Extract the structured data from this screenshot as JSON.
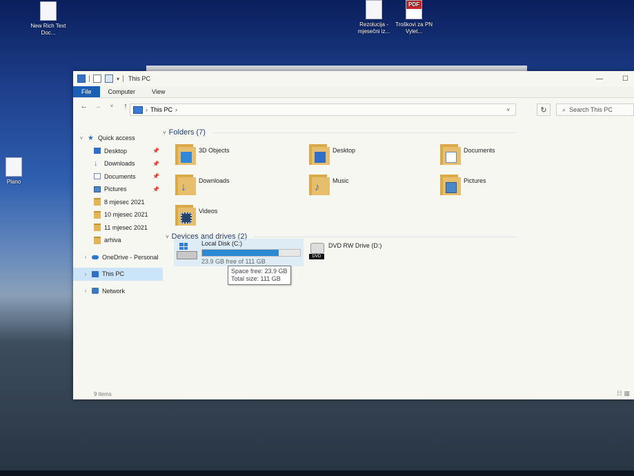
{
  "desktop": {
    "icons": [
      {
        "label": "New Rich Text Doc...",
        "icon": "rtf-document-icon"
      },
      {
        "label": "Rezolucija - mjesečni iz...",
        "icon": "document-icon"
      },
      {
        "label": "Troškovi za PN Vylet...",
        "icon": "pdf-icon",
        "badge": "PDF"
      },
      {
        "label": "Plano",
        "icon": "document-icon"
      }
    ]
  },
  "window": {
    "title": "This PC",
    "ribbon_tabs": [
      "File",
      "Computer",
      "View"
    ],
    "address": {
      "location": "This PC"
    },
    "search_placeholder": "Search This PC"
  },
  "sidebar": {
    "items": [
      {
        "label": "Quick access",
        "icon": "star-icon"
      },
      {
        "label": "Desktop",
        "icon": "desktop-folder-icon",
        "pinned": true
      },
      {
        "label": "Downloads",
        "icon": "download-icon",
        "pinned": true
      },
      {
        "label": "Documents",
        "icon": "documents-icon",
        "pinned": true
      },
      {
        "label": "Pictures",
        "icon": "pictures-icon",
        "pinned": true
      },
      {
        "label": "8 mjesec 2021",
        "icon": "folder-icon"
      },
      {
        "label": "10 mjesec 2021",
        "icon": "folder-icon"
      },
      {
        "label": "11 mjesec 2021",
        "icon": "folder-icon"
      },
      {
        "label": "arhiva",
        "icon": "folder-icon"
      },
      {
        "label": "OneDrive - Personal",
        "icon": "onedrive-icon"
      },
      {
        "label": "This PC",
        "icon": "this-pc-icon",
        "selected": true
      },
      {
        "label": "Network",
        "icon": "network-icon"
      }
    ]
  },
  "content": {
    "folders_header": "Folders (7)",
    "folders": [
      {
        "label": "3D Objects",
        "icon": "3d-objects-folder-icon"
      },
      {
        "label": "Desktop",
        "icon": "desktop-folder-icon"
      },
      {
        "label": "Documents",
        "icon": "documents-folder-icon"
      },
      {
        "label": "Downloads",
        "icon": "downloads-folder-icon"
      },
      {
        "label": "Music",
        "icon": "music-folder-icon"
      },
      {
        "label": "Pictures",
        "icon": "pictures-folder-icon"
      },
      {
        "label": "Videos",
        "icon": "videos-folder-icon"
      }
    ],
    "devices_header": "Devices and drives (2)",
    "drives": [
      {
        "label": "Local Disk (C:)",
        "free_text": "23.9 GB free of 111 GB",
        "used_fraction": 0.785
      },
      {
        "label": "DVD RW Drive (D:)",
        "badge": "DVD"
      }
    ],
    "tooltip": {
      "space_free": "Space free: 23.9 GB",
      "total_size": "Total size: 111 GB"
    }
  },
  "status": {
    "item_count": "9 items"
  },
  "colors": {
    "accent": "#1a5fb4",
    "drive_bar": "#2a8ad4",
    "folder": "#e2b556"
  }
}
